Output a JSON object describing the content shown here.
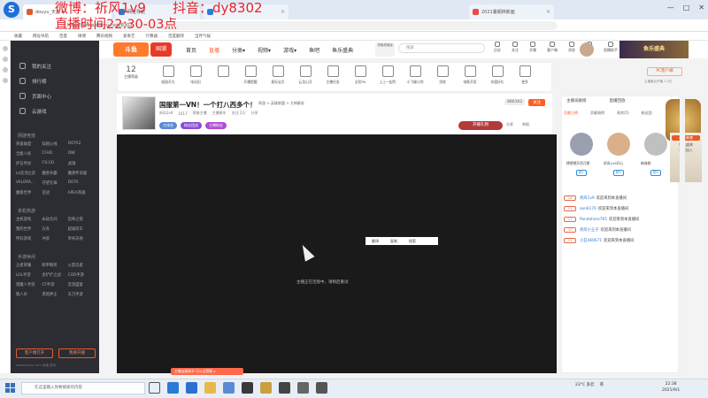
{
  "overlay": {
    "line1": "微博：祈风1v9　　抖音：dy8302",
    "line2": "直播时间22:30-03点"
  },
  "browser": {
    "tabs": [
      {
        "label": "douyu_天天 x",
        "color": "#e05a2a"
      },
      {
        "label": "网址导航",
        "color": "#2c7bd6"
      },
      {
        "label": "",
        "color": "#2c7bd6"
      },
      {
        "label": "2021暑期档新面",
        "color": "#e84a4a"
      }
    ],
    "url": "https://www.douyu.com/8302",
    "bookmarks": [
      "收藏",
      "网址导航",
      "百度",
      "微博",
      "腾讯视频",
      "爱奇艺",
      "计算器",
      "百度翻译",
      "当月气候"
    ]
  },
  "site": {
    "logo": "斗鱼",
    "badge": "国潮",
    "nav": [
      {
        "label": "首页"
      },
      {
        "label": "直播",
        "active": true
      },
      {
        "label": "分类▾"
      },
      {
        "label": "视频▾"
      },
      {
        "label": "游戏▾"
      },
      {
        "label": "鱼吧"
      },
      {
        "label": "鱼乐盛典"
      }
    ],
    "badge2": "领取超值版",
    "search_placeholder": "搜索",
    "header_icons": [
      "历史",
      "关注",
      "开播",
      "客户端",
      "消息",
      "吉祥",
      "直播助手"
    ],
    "banner": "鱼乐盛典"
  },
  "sidebar": {
    "items": [
      "我的关注",
      "排行榜",
      "页面中心",
      "云游戏"
    ],
    "sections": [
      {
        "title": "网游竞技",
        "games": [
          "英雄联盟",
          "穿越火线",
          "DOTA2",
          "全能人民",
          "CFHD",
          "DNF",
          "炉石传说",
          "CS:GO",
          "滤镜",
          "lol云顶之弈",
          "魔兽争霸",
          "魔兽怀旧版",
          "VALORA...",
          "守望先锋",
          "DOTA",
          "魔兽世界",
          "逆战",
          "APEX英雄"
        ]
      },
      {
        "title": "单机热游",
        "games": [
          "主机游戏",
          "永劫无间",
          "恐怖之夜",
          "我的世界",
          "方舟",
          "超级房车",
          "怀旧游戏",
          "冲浪",
          "单机天地"
        ]
      },
      {
        "title": "手游休闲",
        "games": [
          "王者荣耀",
          "和平精英",
          "火影忍者",
          "LOL手游",
          "金铲铲之战",
          "COD手游",
          "猎魔人手游",
          "CF手游",
          "云游盛宴",
          "狼人杀",
          "黑暗神王",
          "天刀手游"
        ]
      }
    ],
    "btn_client": "客户端打开",
    "btn_stream": "我要开播",
    "footer": "www.douyu.com  鱼塘 游戏"
  },
  "toolbar": {
    "level_num": "12",
    "level_label": "主播等级",
    "icons": [
      "顺鼓开光",
      "电动田",
      "",
      "开播提醒",
      "星际宝贝",
      "云龙山河",
      "主播任务",
      "全民PK",
      "上上一起钓",
      "小飞碟计划",
      "剑侠",
      "电影开奖",
      "充值好礼",
      "更多"
    ],
    "pc_btn": "PC客户端",
    "pc_sub": "主播最近开播 1.2亿"
  },
  "room": {
    "title": "国服第一VN！一个打八西多个！",
    "category": "网游 > 英雄联盟 > 大神解说",
    "line2": [
      "祈风1v9",
      "1617",
      "荣誉主播",
      "主播乘车",
      "关注 2万",
      "分享"
    ],
    "tags": [
      "大排名",
      "粉丝团战",
      "主播粉丝"
    ],
    "follow_count": "886302",
    "follow_btn": "关注",
    "open_btn": "开播礼物",
    "share": "分享",
    "report": "举报"
  },
  "video": {
    "ctx_menu": [
      "翻译",
      "复制",
      "搜索"
    ],
    "message": "主播正在连接中，请稍后重试",
    "toast": "主播连载情节 可以点赞哦 x"
  },
  "right": {
    "tabs": [
      "主播贡献榜",
      "直播回放"
    ],
    "subtabs": [
      "贡献日榜",
      "贡献周榜",
      "贵宾(5)",
      "粉丝团"
    ],
    "top": [
      {
        "name": "德德德开西可斯",
        "lv": "粉1"
      },
      {
        "name": "祈风1v9开心",
        "lv": "粉9"
      },
      {
        "name": "梅海群",
        "lv": "粉9"
      }
    ],
    "promo": [
      "高能来袭",
      "鱼乐盛典",
      "全民加入"
    ],
    "chat": [
      {
        "lv": "14",
        "name": "祈风1v9",
        "text": "欢迎来到本直播间"
      },
      {
        "lv": "11",
        "name": "axn6170",
        "text": "欢迎来到本直播间"
      },
      {
        "lv": "11",
        "name": "Pandahero765",
        "text": "欢迎来到本直播间"
      },
      {
        "lv": "12",
        "name": "祈风小王子",
        "text": "欢迎来到本直播间"
      },
      {
        "lv": "11",
        "name": "小丑460671",
        "text": "欢迎来到本直播间"
      }
    ]
  },
  "taskbar": {
    "search": "在这里输入你要搜索的内容",
    "weather": "23°C 多云",
    "ime": "英",
    "time": "22:38",
    "date": "2021/9/1"
  }
}
